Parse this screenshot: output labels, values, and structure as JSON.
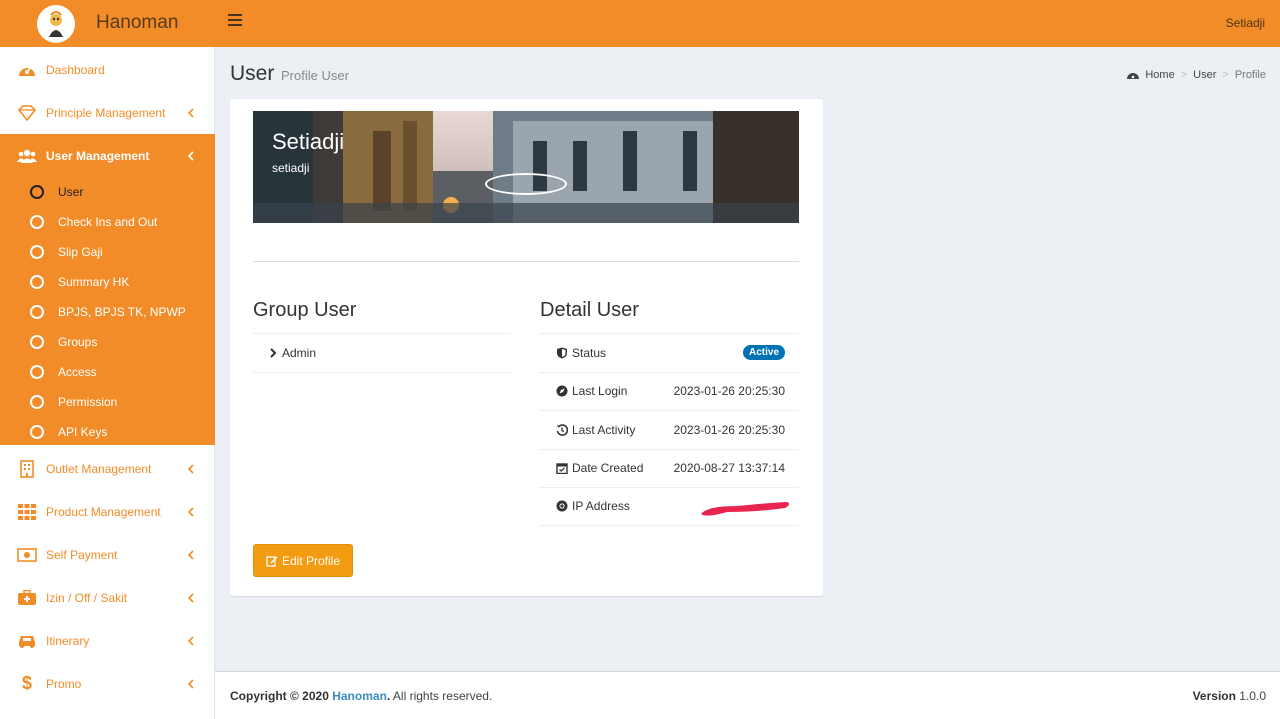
{
  "app": {
    "title": "Hanoman",
    "user": "Setiadji"
  },
  "sidebar": {
    "items": [
      {
        "label": "Dashboard",
        "icon": "dashboard-icon"
      },
      {
        "label": "Principle Management",
        "icon": "diamond-icon"
      },
      {
        "label": "User Management",
        "icon": "users-icon"
      },
      {
        "label": "Outlet Management",
        "icon": "building-icon"
      },
      {
        "label": "Product Management",
        "icon": "grid-icon"
      },
      {
        "label": "Self Payment",
        "icon": "money-icon"
      },
      {
        "label": "Izin / Off / Sakit",
        "icon": "medkit-icon"
      },
      {
        "label": "Itinerary",
        "icon": "car-icon"
      },
      {
        "label": "Promo",
        "icon": "dollar-icon"
      }
    ],
    "submenu": [
      "User",
      "Check Ins and Out",
      "Slip Gaji",
      "Summary HK",
      "BPJS, BPJS TK, NPWP",
      "Groups",
      "Access",
      "Permission",
      "API Keys"
    ]
  },
  "page": {
    "title": "User",
    "subtitle": "Profile User"
  },
  "breadcrumb": {
    "home": "Home",
    "user": "User",
    "profile": "Profile"
  },
  "profile": {
    "name": "Setiadji",
    "username": "setiadji"
  },
  "group": {
    "title": "Group User",
    "items": [
      "Admin"
    ]
  },
  "detail": {
    "title": "Detail User",
    "status_label": "Status",
    "status_value": "Active",
    "last_login_label": "Last Login",
    "last_login_value": "2023-01-26 20:25:30",
    "last_activity_label": "Last Activity",
    "last_activity_value": "2023-01-26 20:25:30",
    "date_created_label": "Date Created",
    "date_created_value": "2020-08-27 13:37:14",
    "ip_label": "IP Address"
  },
  "edit_button": "Edit Profile",
  "footer": {
    "copyright_prefix": "Copyright © 2020",
    "brand": "Hanoman",
    "suffix": ". All rights reserved.",
    "version_label": "Version",
    "version_value": "1.0.0"
  },
  "colors": {
    "primary": "#f28c28",
    "badge": "#0073b7",
    "button": "#f39c12"
  }
}
